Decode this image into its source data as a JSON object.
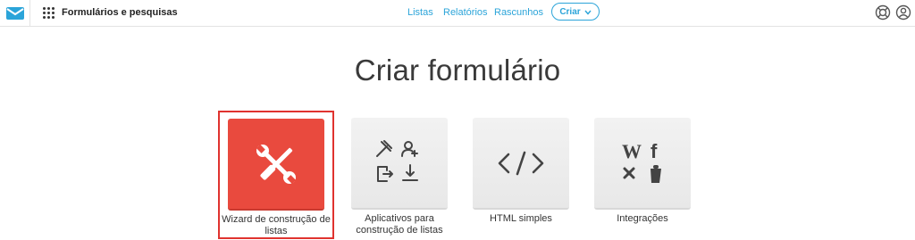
{
  "header": {
    "app_title": "Formulários e pesquisas",
    "nav": [
      "Listas",
      "Relatórios",
      "Rascunhos"
    ],
    "create_label": "Criar",
    "icons": {
      "logo": "envelope-icon",
      "apps": "grid-icon",
      "help": "lifebuoy-icon",
      "account": "user-icon"
    }
  },
  "main": {
    "title": "Criar formulário",
    "options": [
      {
        "label": "Wizard de construção de listas",
        "icon": "wrench-screwdriver-icon",
        "selected": true
      },
      {
        "label": "Aplicativos para construção de listas",
        "icon": "apps-tools-icon",
        "selected": false
      },
      {
        "label": "HTML simples",
        "icon": "code-icon",
        "selected": false
      },
      {
        "label": "Integrações",
        "icon": "integrations-icon",
        "selected": false
      }
    ]
  },
  "colors": {
    "accent": "#2ba4d9",
    "selected_tile": "#e94a3e",
    "selection_border": "#e0332f"
  }
}
